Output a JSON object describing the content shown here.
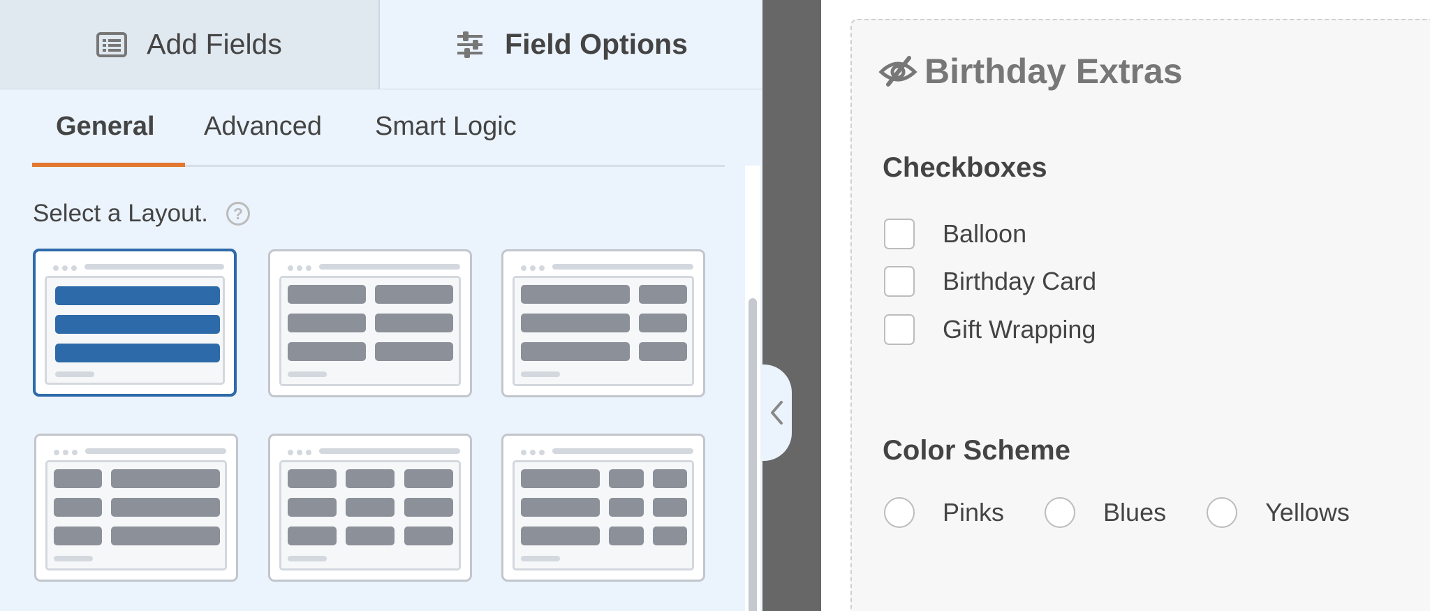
{
  "tabs": {
    "add_fields": "Add Fields",
    "field_options": "Field Options"
  },
  "subtabs": {
    "general": "General",
    "advanced": "Advanced",
    "smart_logic": "Smart Logic"
  },
  "layout": {
    "label": "Select a Layout.",
    "help_icon": "?",
    "selected": "one-column"
  },
  "form": {
    "title": "Birthday Extras",
    "title_icon": "eye-slash-icon",
    "checkbox_label": "Checkboxes",
    "checkboxes": [
      "Balloon",
      "Birthday Card",
      "Gift Wrapping"
    ],
    "radio_label": "Color Scheme",
    "radios": [
      "Pinks",
      "Blues",
      "Yellows"
    ]
  },
  "colors": {
    "accent_orange": "#e27730",
    "selected_blue": "#2d6aa9",
    "panel_bg": "#ebf3fc"
  }
}
